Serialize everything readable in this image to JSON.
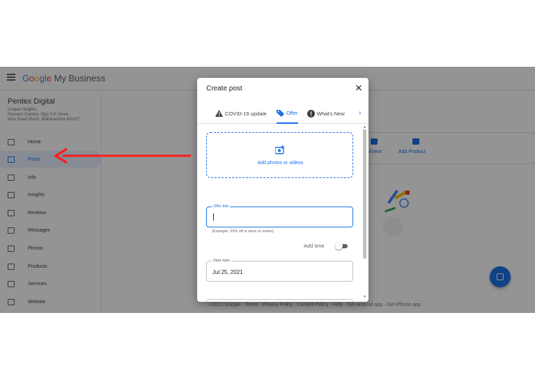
{
  "app": {
    "brand": {
      "g": "G",
      "o1": "o",
      "o2": "o",
      "g2": "g",
      "l": "l",
      "e": "e",
      "rest": " My Business"
    }
  },
  "business": {
    "name": "Pentex Digital",
    "address_lines": [
      "Unique Heights,",
      "Poonam Garden, Opp S K Stone",
      "Mira Road (East), Maharashtra 401107"
    ]
  },
  "sidebar": {
    "items": [
      {
        "label": "Home",
        "icon": "dashboard-icon"
      },
      {
        "label": "Posts",
        "icon": "posts-icon",
        "active": true
      },
      {
        "label": "Info",
        "icon": "store-icon"
      },
      {
        "label": "Insights",
        "icon": "bar-chart-icon"
      },
      {
        "label": "Reviews",
        "icon": "reviews-icon"
      },
      {
        "label": "Messages",
        "icon": "messages-icon"
      },
      {
        "label": "Photos",
        "icon": "photos-icon"
      },
      {
        "label": "Products",
        "icon": "basket-icon"
      },
      {
        "label": "Services",
        "icon": "list-icon"
      },
      {
        "label": "Website",
        "icon": "website-icon"
      }
    ]
  },
  "quick_actions": {
    "event_partial": "d Event",
    "add_product": "Add Product"
  },
  "footer": {
    "text": "©2021 Google  ·  Terms  ·  Privacy Policy  ·  Content Policy  ·  Help  ·  Get Android app  ·  Get iPhone app"
  },
  "dialog": {
    "title": "Create post",
    "close_icon": "close-icon",
    "tabs": [
      {
        "label": "COVID-19 update",
        "icon": "warning-icon"
      },
      {
        "label": "Offer",
        "icon": "tag-icon",
        "active": true
      },
      {
        "label": "What's New",
        "icon": "announcement-icon"
      }
    ],
    "upload_label": "Add photos or videos",
    "offer_title": {
      "label": "Offer title",
      "value": ""
    },
    "offer_hint": "(Example: 20% off in store or online)",
    "add_time": {
      "label": "Add time",
      "on": false
    },
    "start_date": {
      "label": "Start date",
      "value": "Jul 25, 2021"
    }
  },
  "colors": {
    "accent": "#1a73e8",
    "annotation_arrow": "#ff1a1a"
  }
}
